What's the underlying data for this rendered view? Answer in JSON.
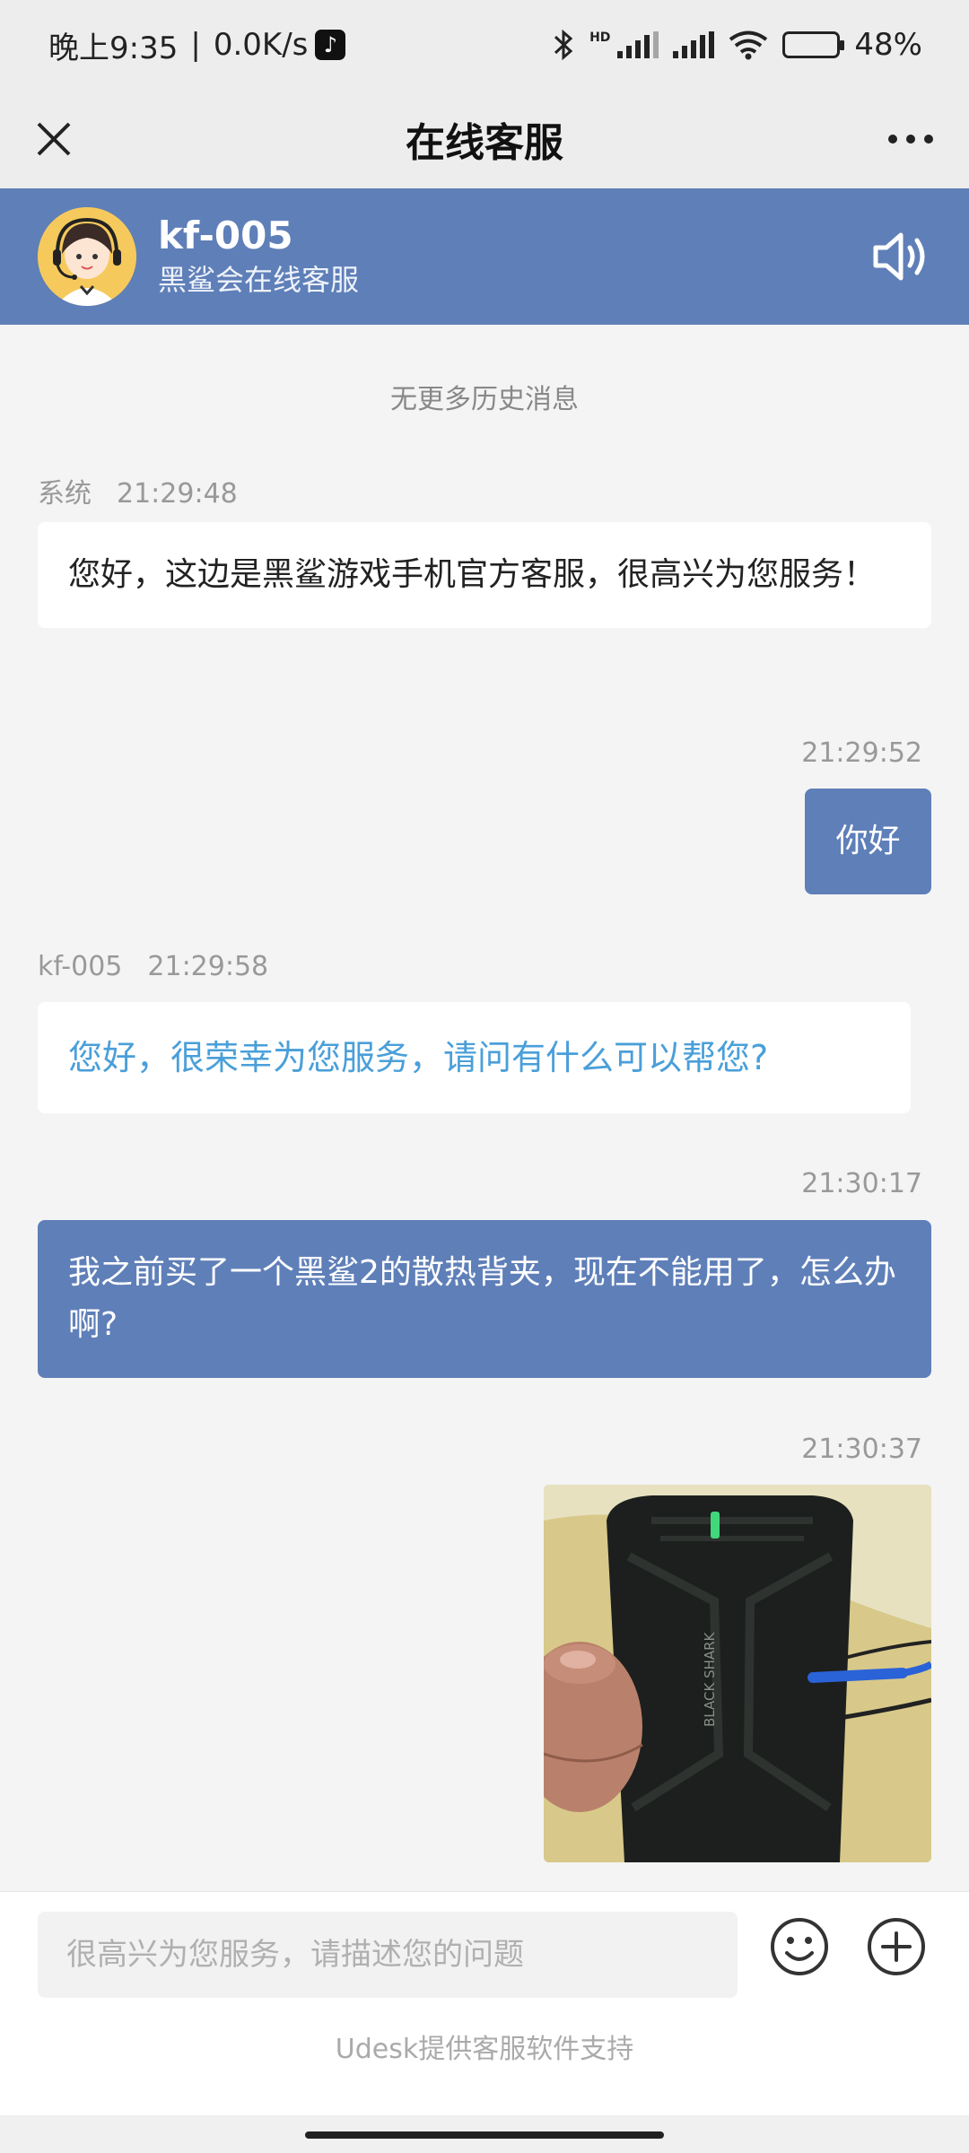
{
  "status_bar": {
    "time": "晚上9:35",
    "separator": "|",
    "speed": "0.0K/s",
    "tiktok_glyph": "♪",
    "hd_label": "HD",
    "battery_text": "48%",
    "battery_level": 0.48
  },
  "title_bar": {
    "title": "在线客服",
    "close_icon": "close-icon",
    "more_icon": "more-icon"
  },
  "agent": {
    "name": "kf-005",
    "subtitle": "黑鲨会在线客服",
    "speaker_icon": "speaker-icon"
  },
  "chat": {
    "no_more": "无更多历史消息",
    "messages": [
      {
        "sender": "系统",
        "time": "21:29:48",
        "side": "left",
        "text": "您好，这边是黑鲨游戏手机官方客服，很高兴为您服务！"
      },
      {
        "sender": "",
        "time": "21:29:52",
        "side": "right",
        "text": "你好"
      },
      {
        "sender": "kf-005",
        "time": "21:29:58",
        "side": "left",
        "text": "您好，很荣幸为您服务，请问有什么可以帮您?"
      },
      {
        "sender": "",
        "time": "21:30:17",
        "side": "right",
        "text": "我之前买了一个黑鲨2的散热背夹，现在不能用了，怎么办啊?"
      },
      {
        "sender": "",
        "time": "21:30:37",
        "side": "right",
        "image_text": "BLACK SHARK"
      }
    ]
  },
  "input": {
    "placeholder": "很高兴为您服务，请描述您的问题",
    "emoji_icon": "emoji-icon",
    "plus_icon": "plus-icon"
  },
  "footer": {
    "powered_by": "Udesk提供客服软件支持"
  },
  "colors": {
    "accent": "#5f7fb8",
    "link": "#4a9fd9",
    "background": "#f4f4f4"
  }
}
